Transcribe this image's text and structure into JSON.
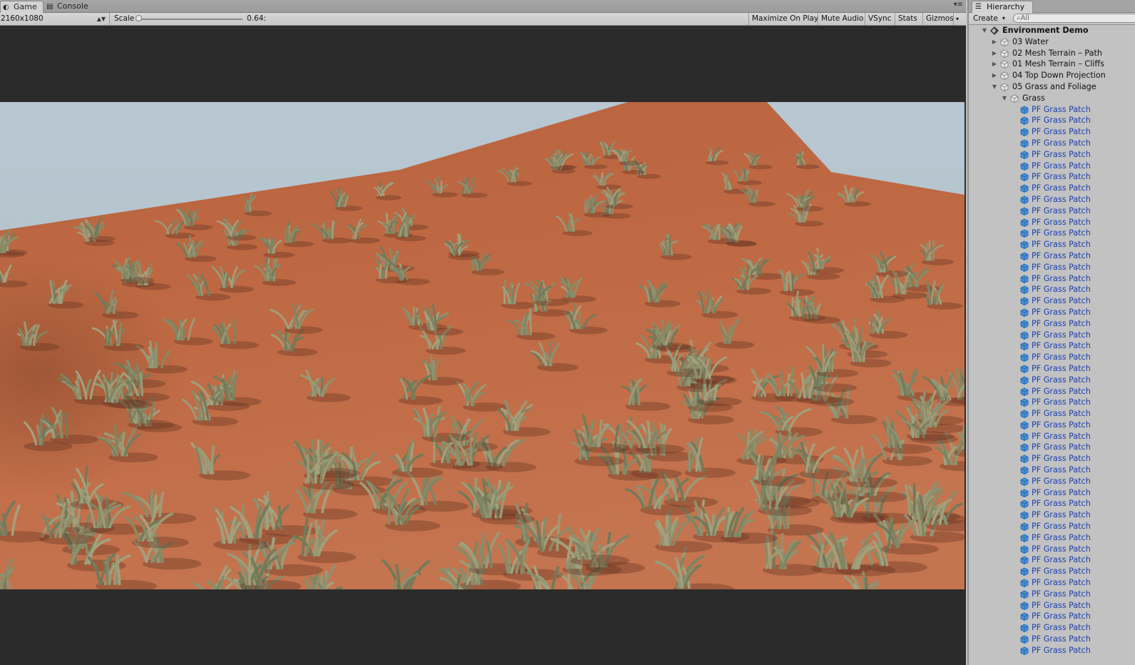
{
  "game": {
    "tabs": [
      {
        "label": "Game",
        "icon": "gamepad-icon",
        "active": true
      },
      {
        "label": "Console",
        "icon": "console-icon",
        "active": false
      }
    ],
    "toolbar": {
      "resolution": "2160x1080",
      "scale_label": "Scale",
      "scale_value": "0.64:",
      "buttons": [
        "Maximize On Play",
        "Mute Audio",
        "VSync",
        "Stats",
        "Gizmos"
      ]
    }
  },
  "hierarchy": {
    "tab_label": "Hierarchy",
    "tab_icon": "list-icon",
    "create_label": "Create",
    "search_placeholder": "All",
    "scene": "Environment Demo",
    "objects": [
      {
        "label": "03 Water",
        "expanded": false
      },
      {
        "label": "02 Mesh Terrain – Path",
        "expanded": false
      },
      {
        "label": "01 Mesh Terrain – Cliffs",
        "expanded": false
      },
      {
        "label": "04 Top Down Projection",
        "expanded": false
      },
      {
        "label": "05 Grass and Foliage",
        "expanded": true
      }
    ],
    "group": "Grass",
    "prefab_label": "PF Grass Patch",
    "prefab_count": 49
  },
  "colors": {
    "prefab_text": "#1c3fb0",
    "sky": "#b3c2cc",
    "terrain": "#b85f3e",
    "grass": "#8d8f6a"
  }
}
